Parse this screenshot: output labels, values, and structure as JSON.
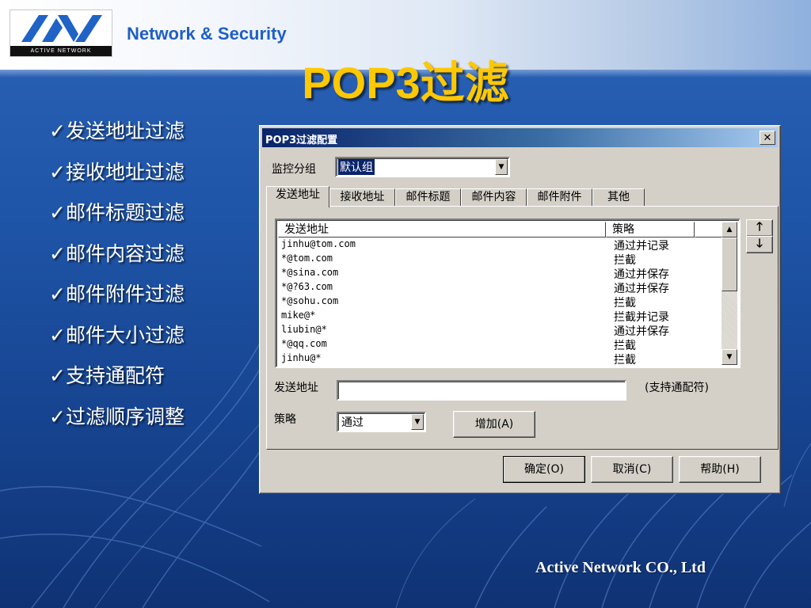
{
  "header": {
    "logo_text": "ACTIVE NETWORK",
    "tagline": "Network & Security"
  },
  "slide": {
    "title": "POP3过滤",
    "bullets": [
      "发送地址过滤",
      "接收地址过滤",
      "邮件标题过滤",
      "邮件内容过滤",
      "邮件附件过滤",
      "邮件大小过滤",
      "支持通配符",
      "过滤顺序调整"
    ],
    "bullet_mark": "✓"
  },
  "footer": {
    "company": "Active Network CO., Ltd"
  },
  "dialog": {
    "title": "POP3过滤配置",
    "close_glyph": "✕",
    "group_label": "监控分组",
    "group_value": "默认组",
    "tabs": [
      "发送地址",
      "接收地址",
      "邮件标题",
      "邮件内容",
      "邮件附件",
      "其他"
    ],
    "active_tab": "发送地址",
    "list": {
      "columns": [
        "发送地址",
        "策略"
      ],
      "rows": [
        {
          "address": "jinhu@tom.com",
          "policy": "通过并记录"
        },
        {
          "address": "*@tom.com",
          "policy": "拦截"
        },
        {
          "address": "*@sina.com",
          "policy": "通过并保存"
        },
        {
          "address": "*@?63.com",
          "policy": "通过并保存"
        },
        {
          "address": "*@sohu.com",
          "policy": "拦截"
        },
        {
          "address": "mike@*",
          "policy": "拦截并记录"
        },
        {
          "address": "liubin@*",
          "policy": "通过并保存"
        },
        {
          "address": "*@qq.com",
          "policy": "拦截"
        },
        {
          "address": "jinhu@*",
          "policy": "拦截"
        }
      ]
    },
    "move_up_glyph": "🡑",
    "move_down_glyph": "🡓",
    "address_label": "发送地址",
    "address_value": "",
    "address_hint": "(支持通配符)",
    "policy_label": "策略",
    "policy_value": "通过",
    "add_button": "增加(A)",
    "ok_button": "确定(O)",
    "cancel_button": "取消(C)",
    "help_button": "帮助(H)"
  },
  "colors": {
    "title": "#ffc800",
    "slide_background": "#1f55a8",
    "tagline": "#1f5fc6",
    "dialog_face": "#d4d0c8",
    "titlebar": "#0a246a"
  }
}
